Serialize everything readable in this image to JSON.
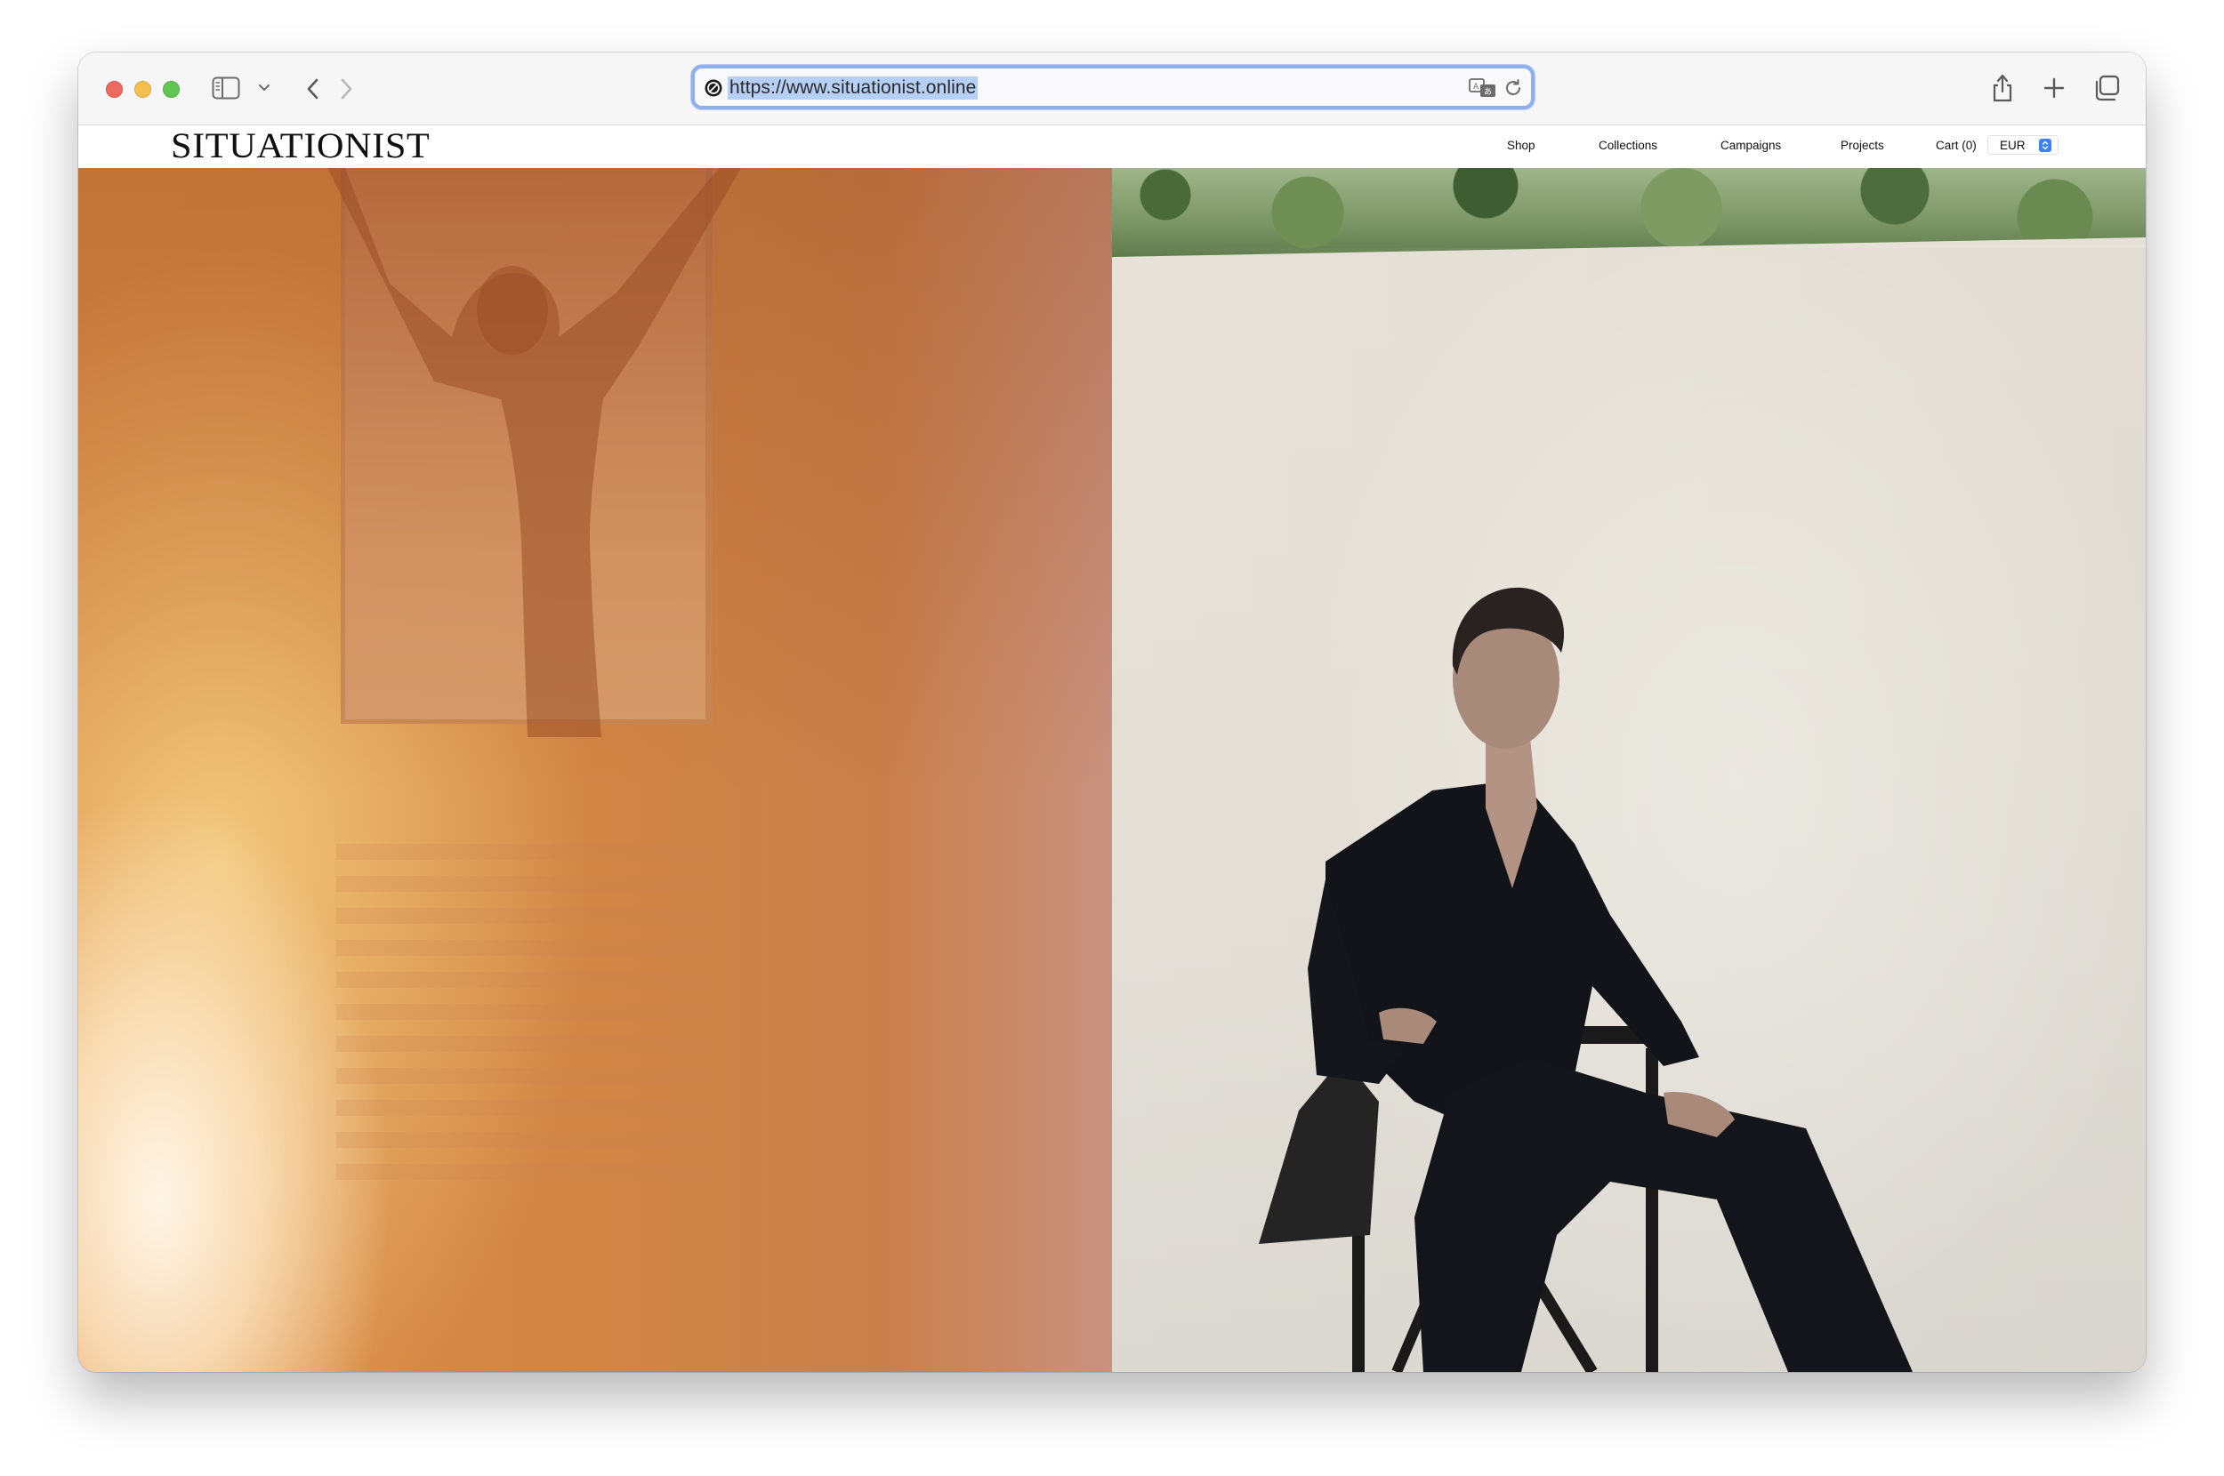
{
  "browser": {
    "url": "https://www.situationist.online"
  },
  "site": {
    "logo": "SITUATIONIST",
    "nav": {
      "shop": "Shop",
      "collections": "Collections",
      "campaigns": "Campaigns",
      "projects": "Projects",
      "cart": "Cart (0)"
    },
    "currency": {
      "selected": "EUR"
    }
  },
  "hero": {
    "left_image": "silhouette-at-window-photo",
    "right_image": "seated-model-black-suit-photo"
  },
  "colors": {
    "url_highlight": "#b6cff5",
    "url_focus_ring": "#8fb0ea",
    "select_accent": "#3b82f6",
    "left_panel_orange": "#d88a45",
    "right_panel_wall": "#e6e1d6"
  }
}
